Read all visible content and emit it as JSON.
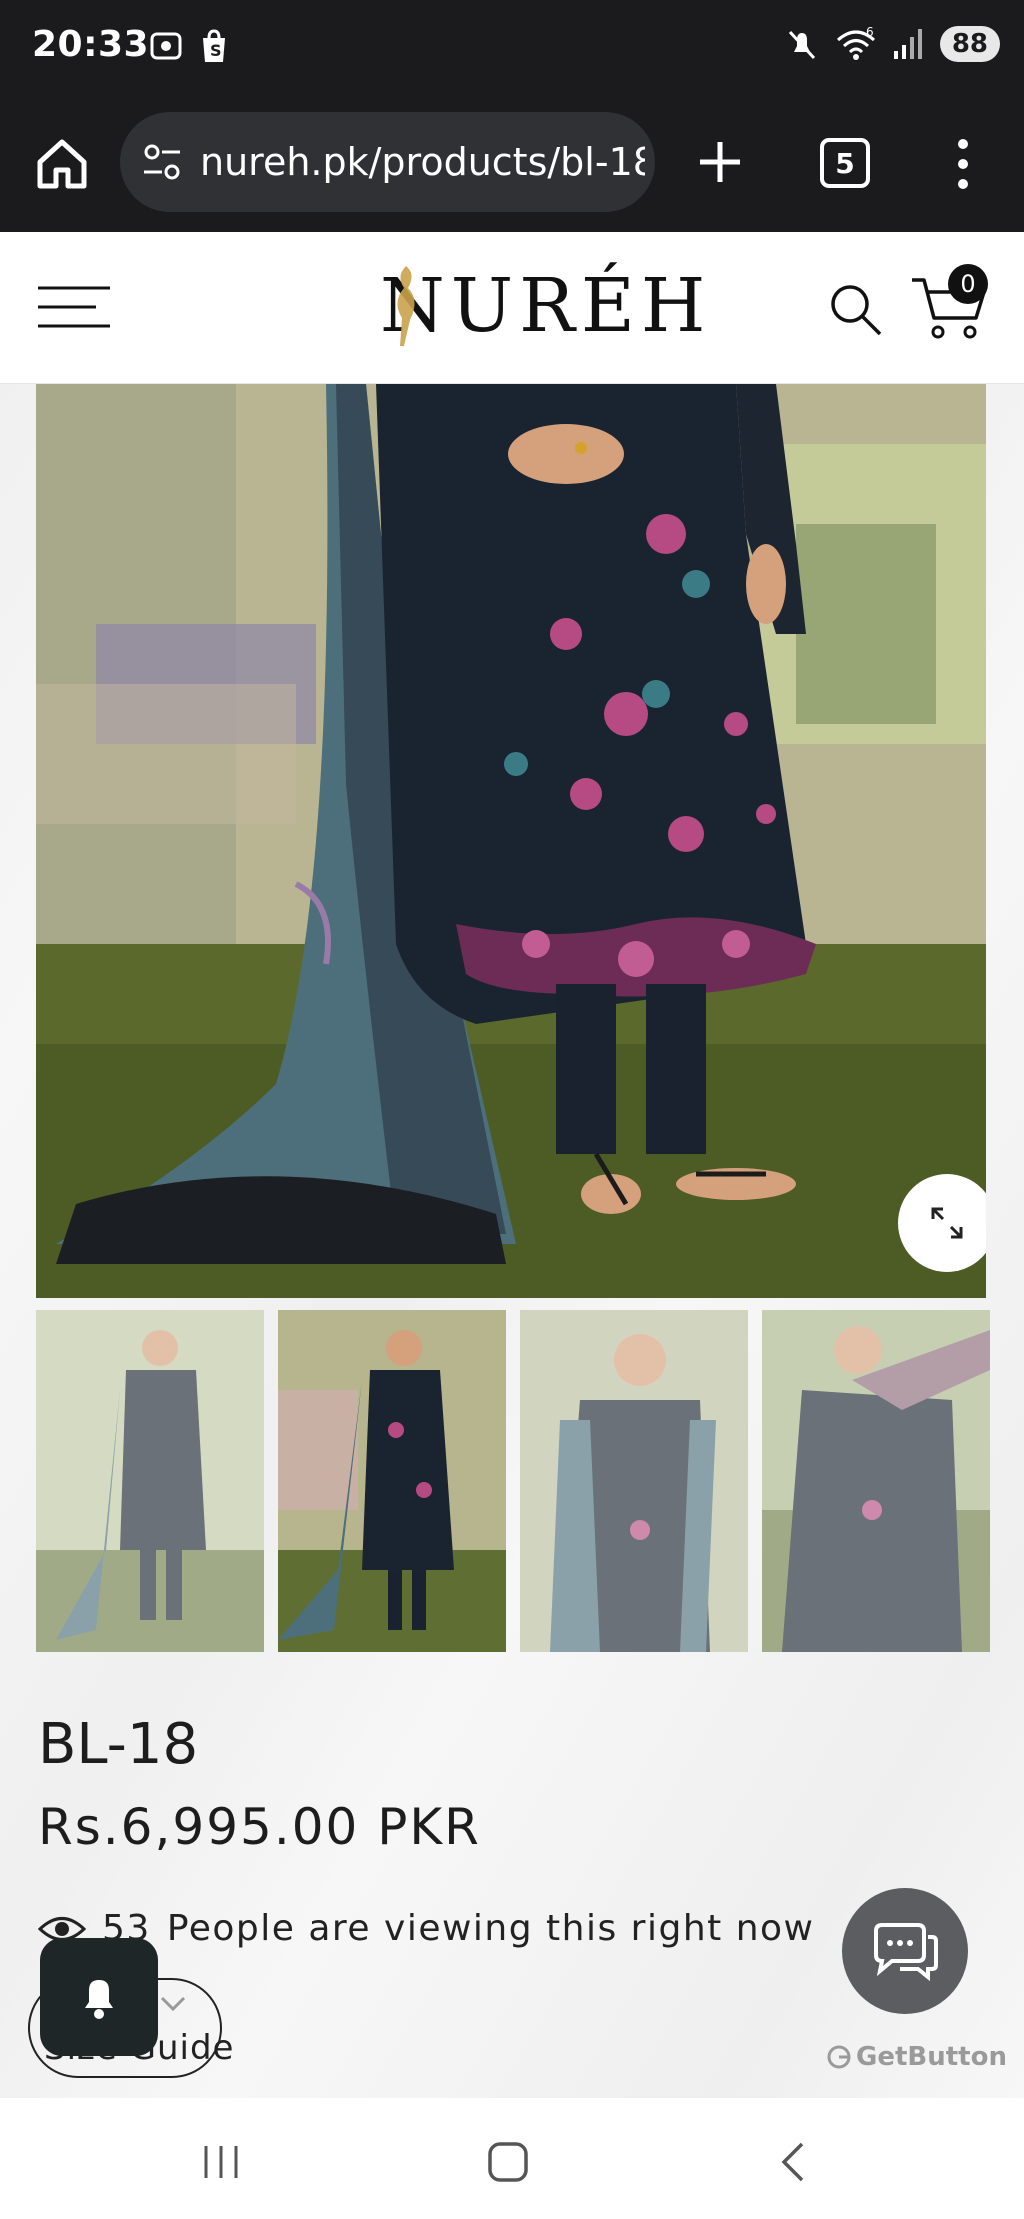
{
  "status_bar": {
    "time": "20:33",
    "wifi_label": "6",
    "battery": "88",
    "icons": [
      "screenshot-icon",
      "shopping-bag-icon",
      "mute-icon",
      "wifi-icon",
      "signal-icon"
    ]
  },
  "browser": {
    "url": "nureh.pk/products/bl-18",
    "tab_count": "5",
    "icons": [
      "home-icon",
      "site-settings-icon",
      "new-tab-icon",
      "more-vert-icon"
    ]
  },
  "site": {
    "logo": "NURÉH",
    "cart_count": "0"
  },
  "product": {
    "title": "BL-18",
    "price": "Rs.6,995.00 PKR",
    "viewers_count": "53",
    "viewers_text": "People are viewing this right now",
    "size_guide": "Size Guide"
  },
  "widgets": {
    "getbutton_label": "GetButton"
  },
  "colors": {
    "status_bar_bg": "#1b1b1d",
    "url_pill_bg": "#2f3134",
    "chat_bg": "#5b5d60",
    "notif_bg": "#1f2628",
    "outfit": "#1a2430"
  }
}
